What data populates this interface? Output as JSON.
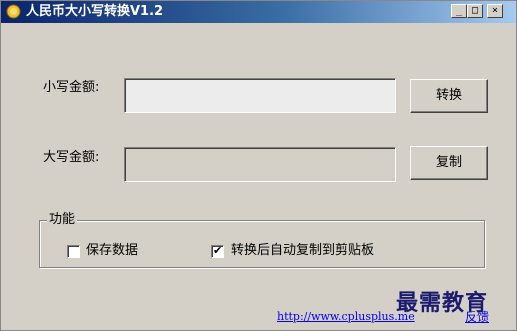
{
  "window": {
    "title": "人民币大小写转换V1.2",
    "controls": {
      "minimize": "_",
      "maximize": "□",
      "close": "×"
    }
  },
  "form": {
    "lower_label": "小写金额:",
    "lower_value": "",
    "upper_label": "大写金额:",
    "upper_value": "",
    "convert_button": "转换",
    "copy_button": "复制"
  },
  "options": {
    "group_title": "功能",
    "save_data_label": "保存数据",
    "save_data_checked": false,
    "auto_copy_label": "转换后自动复制到剪贴板",
    "auto_copy_checked": true,
    "check_mark": "✔"
  },
  "footer": {
    "link": "http://www.cplusplus.me",
    "feedback": "反馈",
    "watermark": "最需教育"
  },
  "colors": {
    "title_gradient_start": "#0a246a",
    "title_gradient_end": "#a6caf0",
    "window_bg": "#d4d0c8",
    "link": "#0000ee"
  }
}
